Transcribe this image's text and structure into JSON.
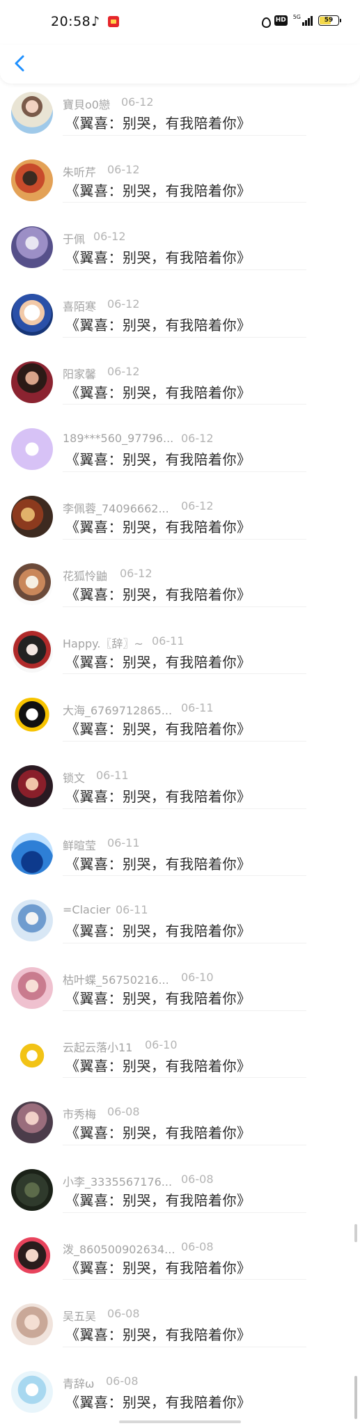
{
  "status_bar": {
    "time": "20:58",
    "network": "5G",
    "hd_label": "HD",
    "battery": "59",
    "icons": [
      "music-note-icon",
      "red-app-icon",
      "water-drop-icon",
      "hd-icon",
      "signal-icon",
      "battery-icon"
    ]
  },
  "nav": {
    "back_icon": "chevron-left-icon",
    "accent": "#1e90ff"
  },
  "message_text": "《翼喜：别哭，有我陪着你》",
  "comments": [
    {
      "user": "寶貝o0戀",
      "date": "06-12"
    },
    {
      "user": "朱听芹",
      "date": "06-12"
    },
    {
      "user": "于佩",
      "date": "06-12"
    },
    {
      "user": "喜陌寒",
      "date": "06-12"
    },
    {
      "user": "阳家馨",
      "date": "06-12"
    },
    {
      "user": "189***560_97796...",
      "date": "06-12"
    },
    {
      "user": "李佩蓉_74096662...",
      "date": "06-12"
    },
    {
      "user": "花狐怜鼬",
      "date": "06-12"
    },
    {
      "user": "Happy.〖辞〗~",
      "date": "06-11"
    },
    {
      "user": "大海_6769712865...",
      "date": "06-11"
    },
    {
      "user": "锁文",
      "date": "06-11"
    },
    {
      "user": "鲜暄莹",
      "date": "06-11"
    },
    {
      "user": "=Clacier",
      "date": "06-11"
    },
    {
      "user": "枯叶蝶_56750216...",
      "date": "06-10"
    },
    {
      "user": "云起云落小11",
      "date": "06-10"
    },
    {
      "user": "市秀梅",
      "date": "06-08"
    },
    {
      "user": "小李_3335567176...",
      "date": "06-08"
    },
    {
      "user": "泼_860500902634...",
      "date": "06-08"
    },
    {
      "user": "吴五吴",
      "date": "06-08"
    },
    {
      "user": "青辞ω",
      "date": "06-08"
    }
  ]
}
